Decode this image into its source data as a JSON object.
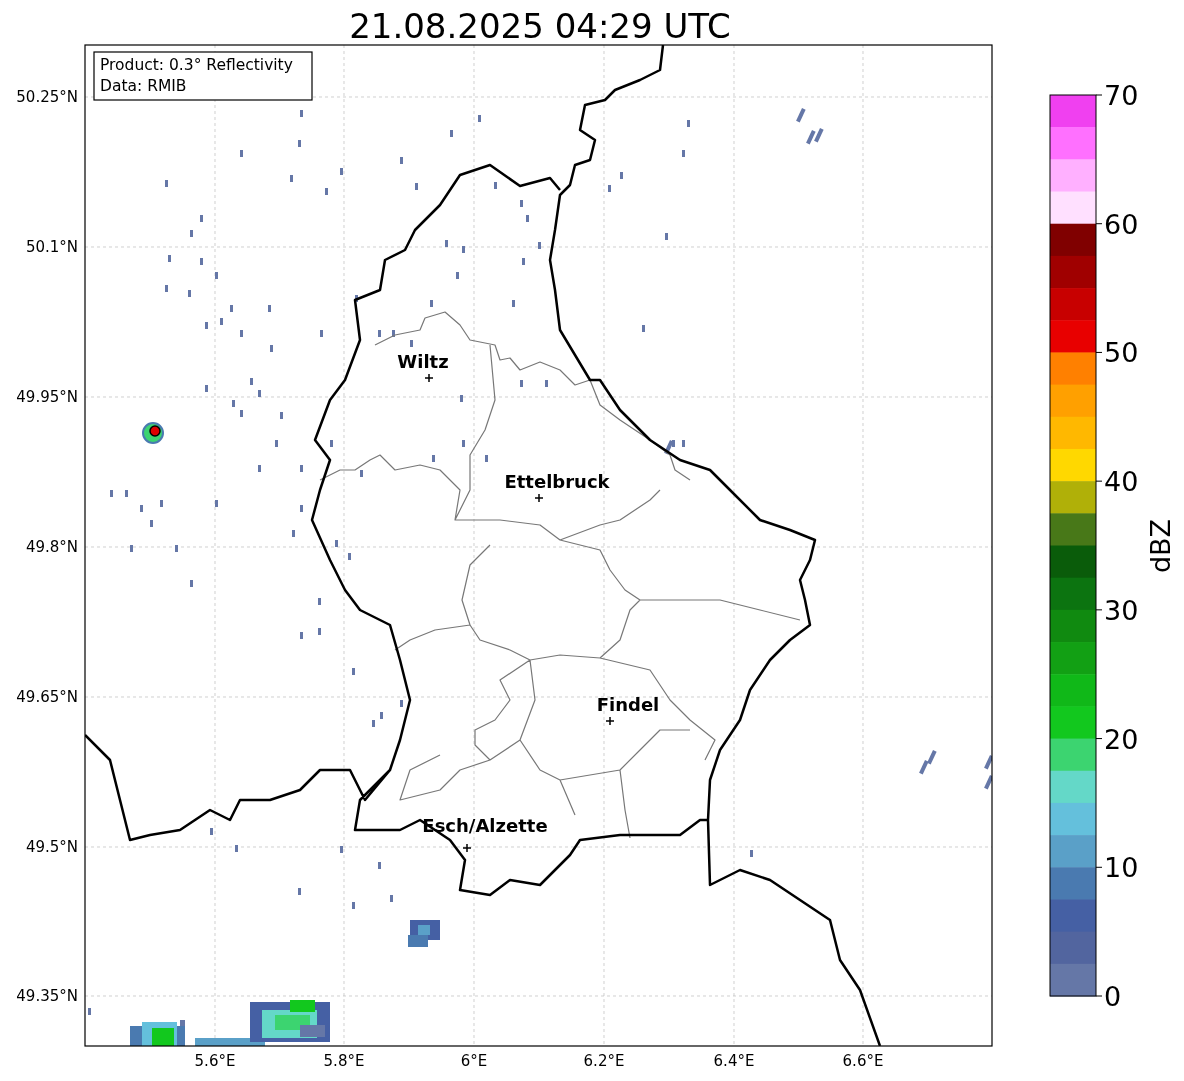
{
  "title": "21.08.2025 04:29 UTC",
  "info_box": [
    "Product: 0.3° Reflectivity",
    "Data: RMIB"
  ],
  "lat_ticks": [
    "50.25°N",
    "50.1°N",
    "49.95°N",
    "49.8°N",
    "49.65°N",
    "49.5°N",
    "49.35°N"
  ],
  "lon_ticks": [
    "5.6°E",
    "5.8°E",
    "6°E",
    "6.2°E",
    "6.4°E",
    "6.6°E"
  ],
  "cities": [
    {
      "name": "Wiltz"
    },
    {
      "name": "Ettelbruck"
    },
    {
      "name": "Findel"
    },
    {
      "name": "Esch/Alzette"
    }
  ],
  "colorbar": {
    "label": "dBZ",
    "ticks": [
      "70",
      "60",
      "50",
      "40",
      "30",
      "20",
      "10",
      "0"
    ],
    "bands": [
      {
        "color": "#f040f0"
      },
      {
        "color": "#ff70ff"
      },
      {
        "color": "#ffb0ff"
      },
      {
        "color": "#ffe0ff"
      },
      {
        "color": "#800000"
      },
      {
        "color": "#a00000"
      },
      {
        "color": "#c80000"
      },
      {
        "color": "#e80000"
      },
      {
        "color": "#ff8000"
      },
      {
        "color": "#ffa000"
      },
      {
        "color": "#ffb800"
      },
      {
        "color": "#ffd800"
      },
      {
        "color": "#b0b008"
      },
      {
        "color": "#487818"
      },
      {
        "color": "#0a5c0a"
      },
      {
        "color": "#0c7410"
      },
      {
        "color": "#108a10"
      },
      {
        "color": "#12a014"
      },
      {
        "color": "#10b818"
      },
      {
        "color": "#12c81e"
      },
      {
        "color": "#3cd470"
      },
      {
        "color": "#64d8c8"
      },
      {
        "color": "#64c0dc"
      },
      {
        "color": "#5aa0c8"
      },
      {
        "color": "#4a7ab0"
      },
      {
        "color": "#4560a4"
      },
      {
        "color": "#52659f"
      },
      {
        "color": "#6577a7"
      }
    ]
  }
}
